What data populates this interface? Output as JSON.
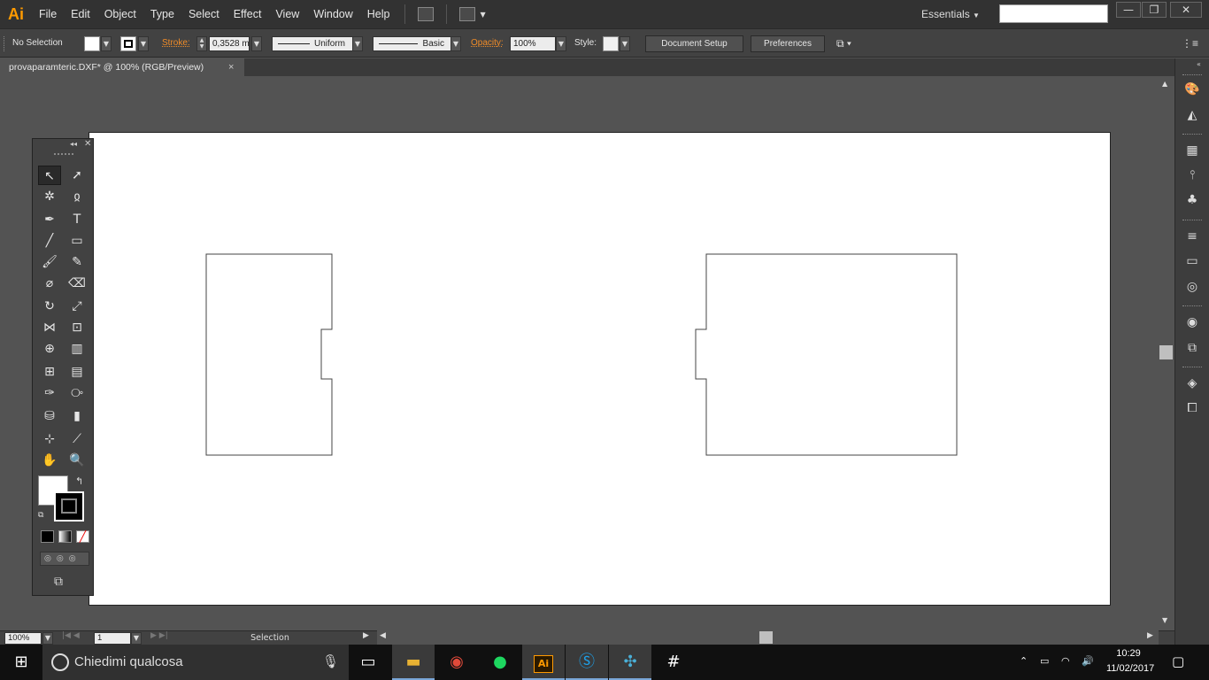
{
  "menubar": {
    "logo": "Ai",
    "items": [
      "File",
      "Edit",
      "Object",
      "Type",
      "Select",
      "Effect",
      "View",
      "Window",
      "Help"
    ],
    "workspace": "Essentials",
    "search_value": ""
  },
  "controlbar": {
    "selection_label": "No Selection",
    "stroke_label": "Stroke:",
    "stroke_value": "0,3528 m",
    "stroke_profile": "Uniform",
    "brush": "Basic",
    "opacity_label": "Opacity:",
    "opacity_value": "100%",
    "style_label": "Style:",
    "document_setup": "Document Setup",
    "preferences": "Preferences"
  },
  "tab": {
    "title": "provaparamteric.DXF* @ 100% (RGB/Preview)",
    "close": "×"
  },
  "statusbar": {
    "zoom": "100%",
    "artboard_number": "1",
    "current_tool": "Selection"
  },
  "taskbar": {
    "search_placeholder": "Chiedimi qualcosa",
    "time": "10:29",
    "date": "11/02/2017"
  },
  "colors": {
    "accent": "#ff9a00",
    "highlight_label": "#f08c28",
    "taskbar_active": "#7aa7d8"
  }
}
